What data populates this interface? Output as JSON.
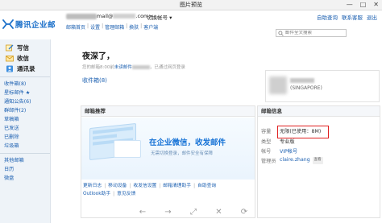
{
  "viewer": {
    "title": "图片预览",
    "window_buttons": [
      "—",
      "□",
      "✕"
    ],
    "toolbar_icons": [
      "←",
      "→",
      "⤢",
      "✕",
      "⟳"
    ]
  },
  "header": {
    "brand": "腾讯企业邮",
    "account_suffix": "mail@",
    "account_domain": ".com>",
    "switch_account": "切换帐号 ▾",
    "top_links": [
      "邮箱首页",
      "设置",
      "管理邮箱",
      "换肤",
      "客户端"
    ],
    "right_links": [
      "自助查询",
      "联系客服",
      "退出"
    ],
    "search_placeholder": "邮件全文搜索"
  },
  "sidebar": {
    "main_nav": [
      {
        "label": "写信",
        "icon": "compose-icon"
      },
      {
        "label": "收信",
        "icon": "inbox-icon"
      },
      {
        "label": "通讯录",
        "icon": "contacts-icon"
      }
    ],
    "folders": [
      "收件箱(8)",
      "星标邮件 ★",
      "通知公告(6)",
      "群邮件(2)",
      "草稿箱",
      "已发送",
      "已删除",
      "垃圾箱"
    ],
    "extra_folders": [
      "其他邮箱",
      "日历",
      "微盘"
    ]
  },
  "main": {
    "greeting": "夜深了，",
    "login_info_prefix": "您的邮箱8:00前",
    "login_info_link": "未读邮件",
    "login_info_suffix": "，已通过网页登录",
    "inbox_label": "收件箱(8)",
    "profile_org": "(SINGAPORE)"
  },
  "recommend": {
    "title": "邮箱推荐",
    "promo_title": "在企业微信，收发邮件",
    "promo_subtitle": "无需切换登录，邮件安全有保障",
    "links_row1": [
      "更新日志",
      "移动设备",
      "收发信设置",
      "邮箱清理助手",
      "自助查询"
    ],
    "links_row2": [
      "Outlook助手",
      "意见反馈"
    ]
  },
  "mailinfo": {
    "title": "邮箱信息",
    "rows": [
      {
        "key": "容量",
        "value": "无限(已使用：8M)"
      },
      {
        "key": "类型",
        "value": "专业版"
      },
      {
        "key": "帐号",
        "value": "VIP帐号"
      },
      {
        "key": "管理员",
        "value": "claire.zhang",
        "tag": "查看"
      }
    ]
  },
  "colors": {
    "brand": "#1a6fc9",
    "link": "#1b5fb0",
    "highlight": "#e02020"
  }
}
